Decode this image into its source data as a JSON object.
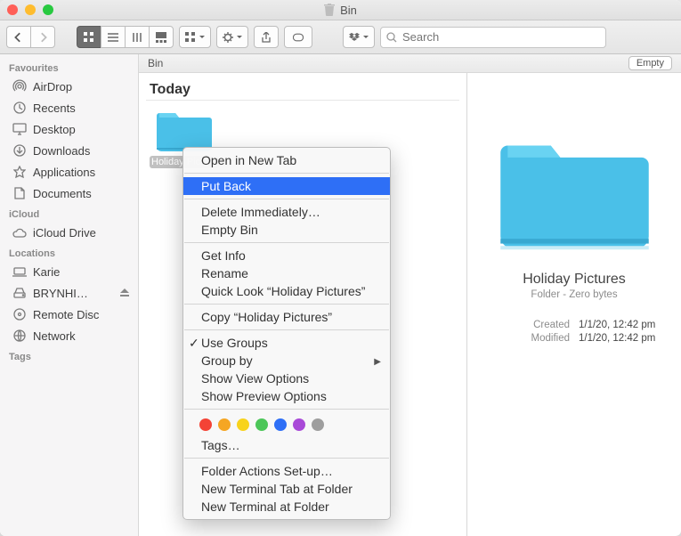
{
  "window": {
    "title": "Bin"
  },
  "toolbar": {
    "search_placeholder": "Search"
  },
  "sidebar": {
    "sections": [
      {
        "title": "Favourites",
        "items": [
          {
            "label": "AirDrop",
            "icon": "airdrop"
          },
          {
            "label": "Recents",
            "icon": "clock"
          },
          {
            "label": "Desktop",
            "icon": "desktop"
          },
          {
            "label": "Downloads",
            "icon": "download"
          },
          {
            "label": "Applications",
            "icon": "app"
          },
          {
            "label": "Documents",
            "icon": "doc"
          }
        ]
      },
      {
        "title": "iCloud",
        "items": [
          {
            "label": "iCloud Drive",
            "icon": "cloud"
          }
        ]
      },
      {
        "title": "Locations",
        "items": [
          {
            "label": "Karie",
            "icon": "laptop"
          },
          {
            "label": "BRYNHI…",
            "icon": "drive",
            "eject": true
          },
          {
            "label": "Remote Disc",
            "icon": "disc"
          },
          {
            "label": "Network",
            "icon": "globe"
          }
        ]
      },
      {
        "title": "Tags",
        "items": []
      }
    ]
  },
  "main": {
    "path": "Bin",
    "empty_label": "Empty",
    "group_header": "Today",
    "item": {
      "name": "Holiday Pictures"
    }
  },
  "preview": {
    "name": "Holiday Pictures",
    "detail": "Folder - Zero bytes",
    "created_label": "Created",
    "modified_label": "Modified",
    "created": "1/1/20, 12:42 pm",
    "modified": "1/1/20, 12:42 pm"
  },
  "ctx": {
    "items": [
      "Open in New Tab",
      "Put Back",
      "Delete Immediately…",
      "Empty Bin",
      "Get Info",
      "Rename",
      "Quick Look “Holiday Pictures”",
      "Copy “Holiday Pictures”",
      "Use Groups",
      "Group by",
      "Show View Options",
      "Show Preview Options",
      "Tags…",
      "Folder Actions Set-up…",
      "New Terminal Tab at Folder",
      "New Terminal at Folder"
    ],
    "tag_colors": [
      "#f44336",
      "#f5a623",
      "#f8d31c",
      "#4cc659",
      "#2e6ff6",
      "#a94ad8",
      "#9e9e9e"
    ]
  }
}
